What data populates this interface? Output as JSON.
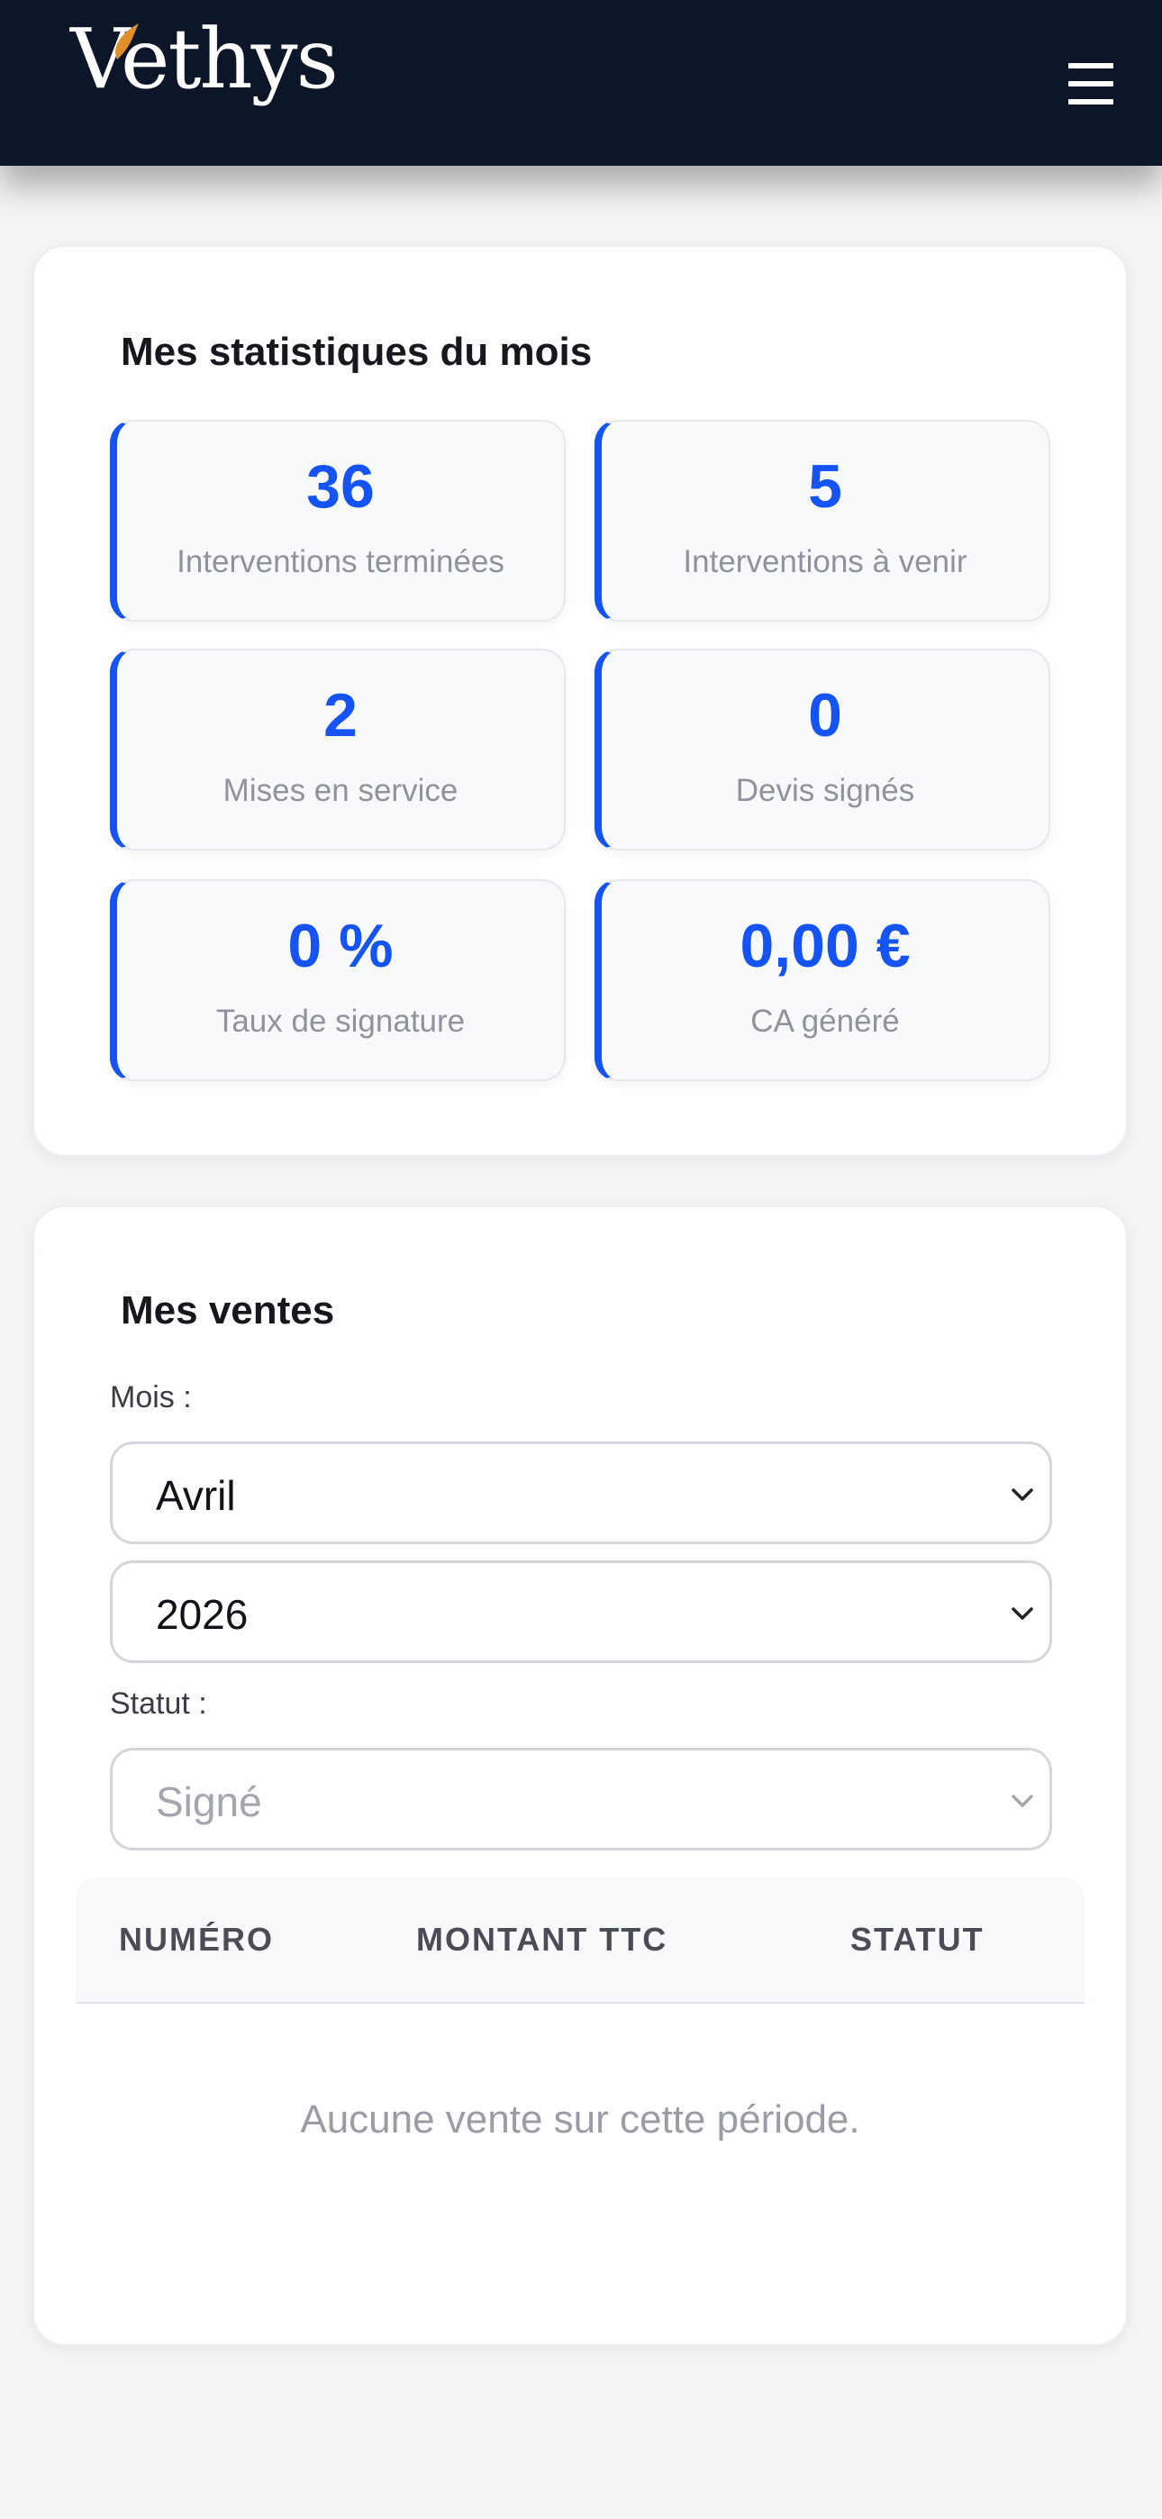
{
  "header": {
    "logo_text": "Vethys",
    "menu_icon": "hamburger-menu-icon",
    "background_color": "#0c1628"
  },
  "stats": {
    "title": "Mes statistiques du mois",
    "accent_color": "#1554f2",
    "items": [
      {
        "value": "36",
        "label": "Interventions terminées"
      },
      {
        "value": "5",
        "label": "Interventions à venir"
      },
      {
        "value": "2",
        "label": "Mises en service"
      },
      {
        "value": "0",
        "label": "Devis signés"
      },
      {
        "value": "0 %",
        "label": "Taux de signature"
      },
      {
        "value": "0,00 €",
        "label": "CA généré"
      }
    ]
  },
  "sales": {
    "title": "Mes ventes",
    "month_label": "Mois :",
    "month_value": "Avril",
    "year_value": "2026",
    "status_label": "Statut :",
    "status_value": "Signé",
    "table": {
      "columns": [
        "NUMÉRO",
        "MONTANT TTC",
        "STATUT"
      ],
      "rows": [],
      "empty_message": "Aucune vente sur cette période."
    }
  }
}
